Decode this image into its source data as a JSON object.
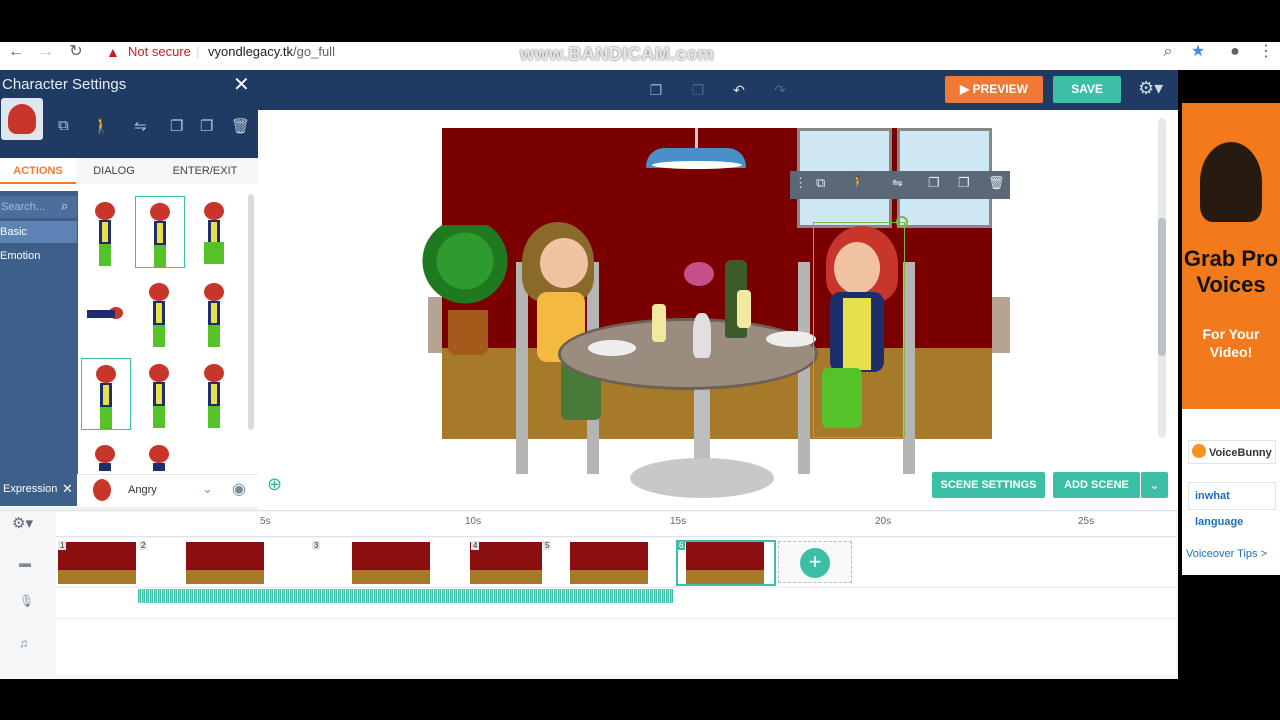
{
  "browser": {
    "url_host": "vyondlegacy.tk",
    "url_path": "/go_full",
    "security_label": "Not secure",
    "watermark": "www.BANDICAM.com"
  },
  "toolbar": {
    "preview_label": "PREVIEW",
    "save_label": "SAVE"
  },
  "character_settings": {
    "title": "Character Settings",
    "tabs": [
      "ACTIONS",
      "DIALOG",
      "ENTER/EXIT"
    ],
    "active_tab": "ACTIONS",
    "search_placeholder": "Search...",
    "categories": [
      "Basic",
      "Emotion"
    ],
    "selected_category": "Basic",
    "expression_label": "Expression",
    "expression_value": "Angry"
  },
  "stage": {
    "scene_settings_label": "SCENE SETTINGS",
    "add_scene_label": "ADD SCENE"
  },
  "timeline": {
    "ticks": [
      "5s",
      "10s",
      "15s",
      "20s",
      "25s"
    ],
    "scene_numbers": [
      "1",
      "2",
      "3",
      "4",
      "5",
      "6"
    ],
    "selected_scene": "6"
  },
  "ad": {
    "headline": "Grab Pro Voices",
    "subline": "For Your Video!",
    "sponsor1": "VoiceBunny",
    "sponsor2": "inwhat language",
    "tips_link": "Voiceover Tips >"
  },
  "colors": {
    "accent_teal": "#3dbfa6",
    "preview_orange": "#f07a35",
    "nav_blue": "#1f3a63"
  }
}
